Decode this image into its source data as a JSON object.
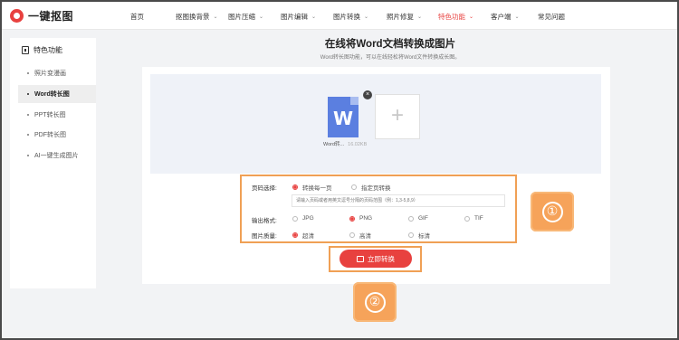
{
  "app": {
    "name": "一键抠图"
  },
  "nav": {
    "items": [
      {
        "label": "首页",
        "has_menu": false,
        "active": false
      },
      {
        "label": "抠图换背景",
        "has_menu": true,
        "active": false
      },
      {
        "label": "图片压缩",
        "has_menu": true,
        "active": false
      },
      {
        "label": "图片编辑",
        "has_menu": true,
        "active": false
      },
      {
        "label": "图片转换",
        "has_menu": true,
        "active": false
      },
      {
        "label": "照片修复",
        "has_menu": true,
        "active": false
      },
      {
        "label": "特色功能",
        "has_menu": true,
        "active": true
      },
      {
        "label": "客户端",
        "has_menu": true,
        "active": false
      },
      {
        "label": "常见问题",
        "has_menu": false,
        "active": false
      }
    ],
    "chevron": "⌄"
  },
  "sidebar": {
    "title": "特色功能",
    "items": [
      {
        "label": "照片变漫画",
        "active": false
      },
      {
        "label": "Word转长图",
        "active": true
      },
      {
        "label": "PPT转长图",
        "active": false
      },
      {
        "label": "PDF转长图",
        "active": false
      },
      {
        "label": "AI一键生成图片",
        "active": false
      }
    ]
  },
  "main": {
    "title": "在线将Word文档转换成图片",
    "subtitle": "Word转长图功能，可以在线轻松将Word文件转换成长图。"
  },
  "upload": {
    "file_letter": "W",
    "file_name": "Word转...",
    "file_size": "16.02KB",
    "close_glyph": "×",
    "add_glyph": "+"
  },
  "options": {
    "page_label": "页码选择:",
    "page_opts": [
      "转换每一页",
      "指定页转换"
    ],
    "page_selected": 0,
    "range_placeholder": "请输入页码或者用英文逗号分隔的页码范围（例：1,3-5,8,9）",
    "format_label": "输出格式:",
    "format_opts": [
      "JPG",
      "PNG",
      "GIF",
      "TIF"
    ],
    "format_selected": 1,
    "quality_label": "图片质量:",
    "quality_opts": [
      "超清",
      "高清",
      "标清"
    ],
    "quality_selected": 0
  },
  "convert": {
    "label": "立即转换"
  },
  "badges": [
    "①",
    "②"
  ],
  "colors": {
    "accent": "#e8413f",
    "highlight": "#f0a055",
    "badge": "#f6a35a",
    "file_icon": "#5b7fe0"
  }
}
